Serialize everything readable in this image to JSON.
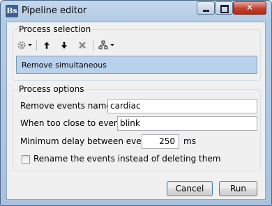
{
  "window": {
    "title": "Pipeline editor",
    "icon_text": "Bs",
    "controls": [
      "minimize-icon",
      "maximize-icon",
      "close-icon"
    ]
  },
  "process_selection": {
    "title": "Process selection",
    "toolbar": [
      "settings-icon",
      "dropdown-arrow-icon",
      "move-up-icon",
      "move-down-icon",
      "delete-icon",
      "pipeline-tree-icon",
      "dropdown-arrow-icon"
    ],
    "items": [
      "Remove simultaneous"
    ],
    "selected_index": 0
  },
  "process_options": {
    "title": "Process options",
    "remove_events_label": "Remove events named:",
    "remove_events_value": "cardiac",
    "too_close_label": "When too close to events:",
    "too_close_value": "blink",
    "min_delay_label": "Minimum delay between events:",
    "min_delay_value": "250",
    "min_delay_unit": "ms",
    "rename_label": "Rename the events instead of deleting them",
    "rename_checked": false
  },
  "buttons": {
    "cancel": "Cancel",
    "run": "Run"
  },
  "colors": {
    "selection": "#b9d1ea",
    "close_button": "#c4402d",
    "frame": "#b3cbe4"
  }
}
